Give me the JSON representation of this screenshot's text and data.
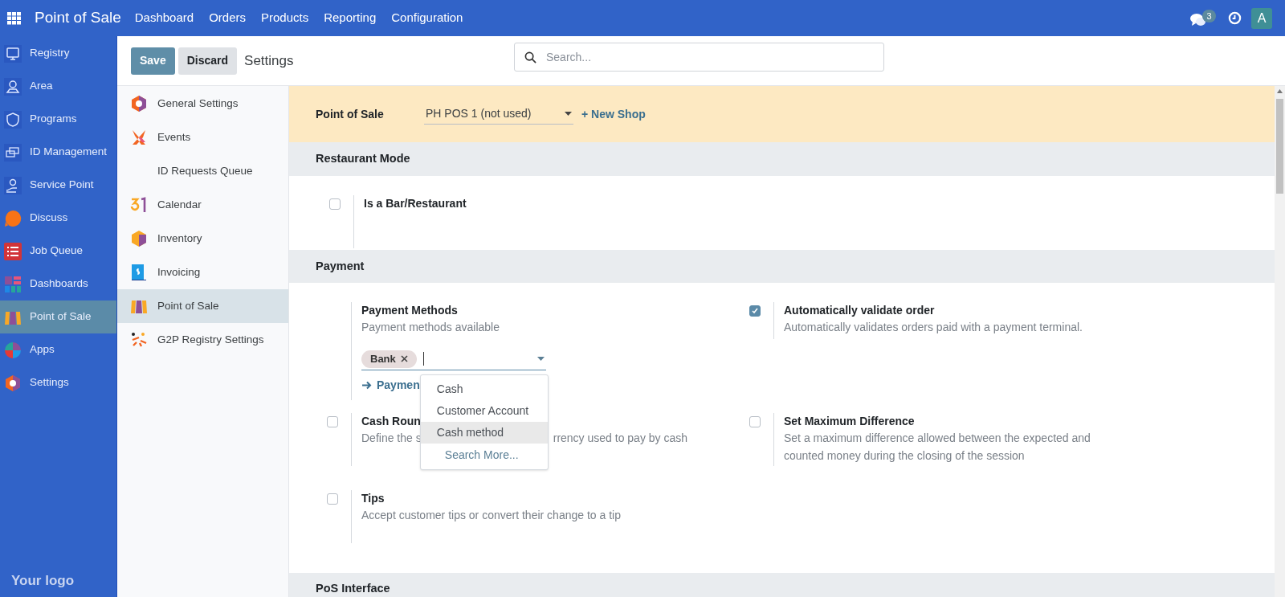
{
  "navbar": {
    "app_title": "Point of Sale",
    "menu": [
      "Dashboard",
      "Orders",
      "Products",
      "Reporting",
      "Configuration"
    ],
    "messages_badge": "3",
    "avatar": "A"
  },
  "app_sidebar": {
    "items": [
      {
        "label": "Registry",
        "selected": false
      },
      {
        "label": "Area",
        "selected": false
      },
      {
        "label": "Programs",
        "selected": false
      },
      {
        "label": "ID Management",
        "selected": false
      },
      {
        "label": "Service Point",
        "selected": false
      },
      {
        "label": "Discuss",
        "selected": false
      },
      {
        "label": "Job Queue",
        "selected": false
      },
      {
        "label": "Dashboards",
        "selected": false
      },
      {
        "label": "Point of Sale",
        "selected": true
      },
      {
        "label": "Apps",
        "selected": false
      },
      {
        "label": "Settings",
        "selected": false
      }
    ],
    "footer_logo": "Your logo"
  },
  "control_panel": {
    "save": "Save",
    "discard": "Discard",
    "title": "Settings",
    "search": {
      "placeholder": "Search..."
    }
  },
  "settings_nav": {
    "items": [
      {
        "label": "General Settings",
        "selected": false
      },
      {
        "label": "Events",
        "selected": false
      },
      {
        "label": "ID Requests Queue",
        "selected": false
      },
      {
        "label": "Calendar",
        "selected": false
      },
      {
        "label": "Inventory",
        "selected": false
      },
      {
        "label": "Invoicing",
        "selected": false
      },
      {
        "label": "Point of Sale",
        "selected": true
      },
      {
        "label": "G2P Registry Settings",
        "selected": false
      }
    ]
  },
  "shop_bar": {
    "label": "Point of Sale",
    "shop": "PH POS 1 (not used)",
    "new_shop": "+ New Shop"
  },
  "restaurant": {
    "title": "Restaurant Mode",
    "setting": {
      "title": "Is a Bar/Restaurant",
      "checked": false
    }
  },
  "payment": {
    "title": "Payment",
    "methods": {
      "title": "Payment Methods",
      "description": "Payment methods available",
      "tags": [
        "Bank"
      ],
      "link": "Paymen",
      "dropdown": {
        "options": [
          {
            "label": "Cash",
            "selected": false
          },
          {
            "label": "Customer Account",
            "selected": false
          },
          {
            "label": "Cash method",
            "selected": true
          }
        ],
        "search_more": "Search More..."
      }
    },
    "auto_validate": {
      "title": "Automatically validate order",
      "description": "Automatically validates orders paid with a payment terminal.",
      "checked": true
    },
    "cash_rounding": {
      "title": "Cash Roun",
      "description_start": "Define the s",
      "description_end": "rrency used to pay by cash",
      "checked": false
    },
    "max_difference": {
      "title": "Set Maximum Difference",
      "description": "Set a maximum difference allowed between the expected and counted money during the closing of the session",
      "checked": false
    },
    "tips": {
      "title": "Tips",
      "description": "Accept customer tips or convert their change to a tip",
      "checked": false
    }
  },
  "pos_interface": {
    "title": "PoS Interface"
  }
}
